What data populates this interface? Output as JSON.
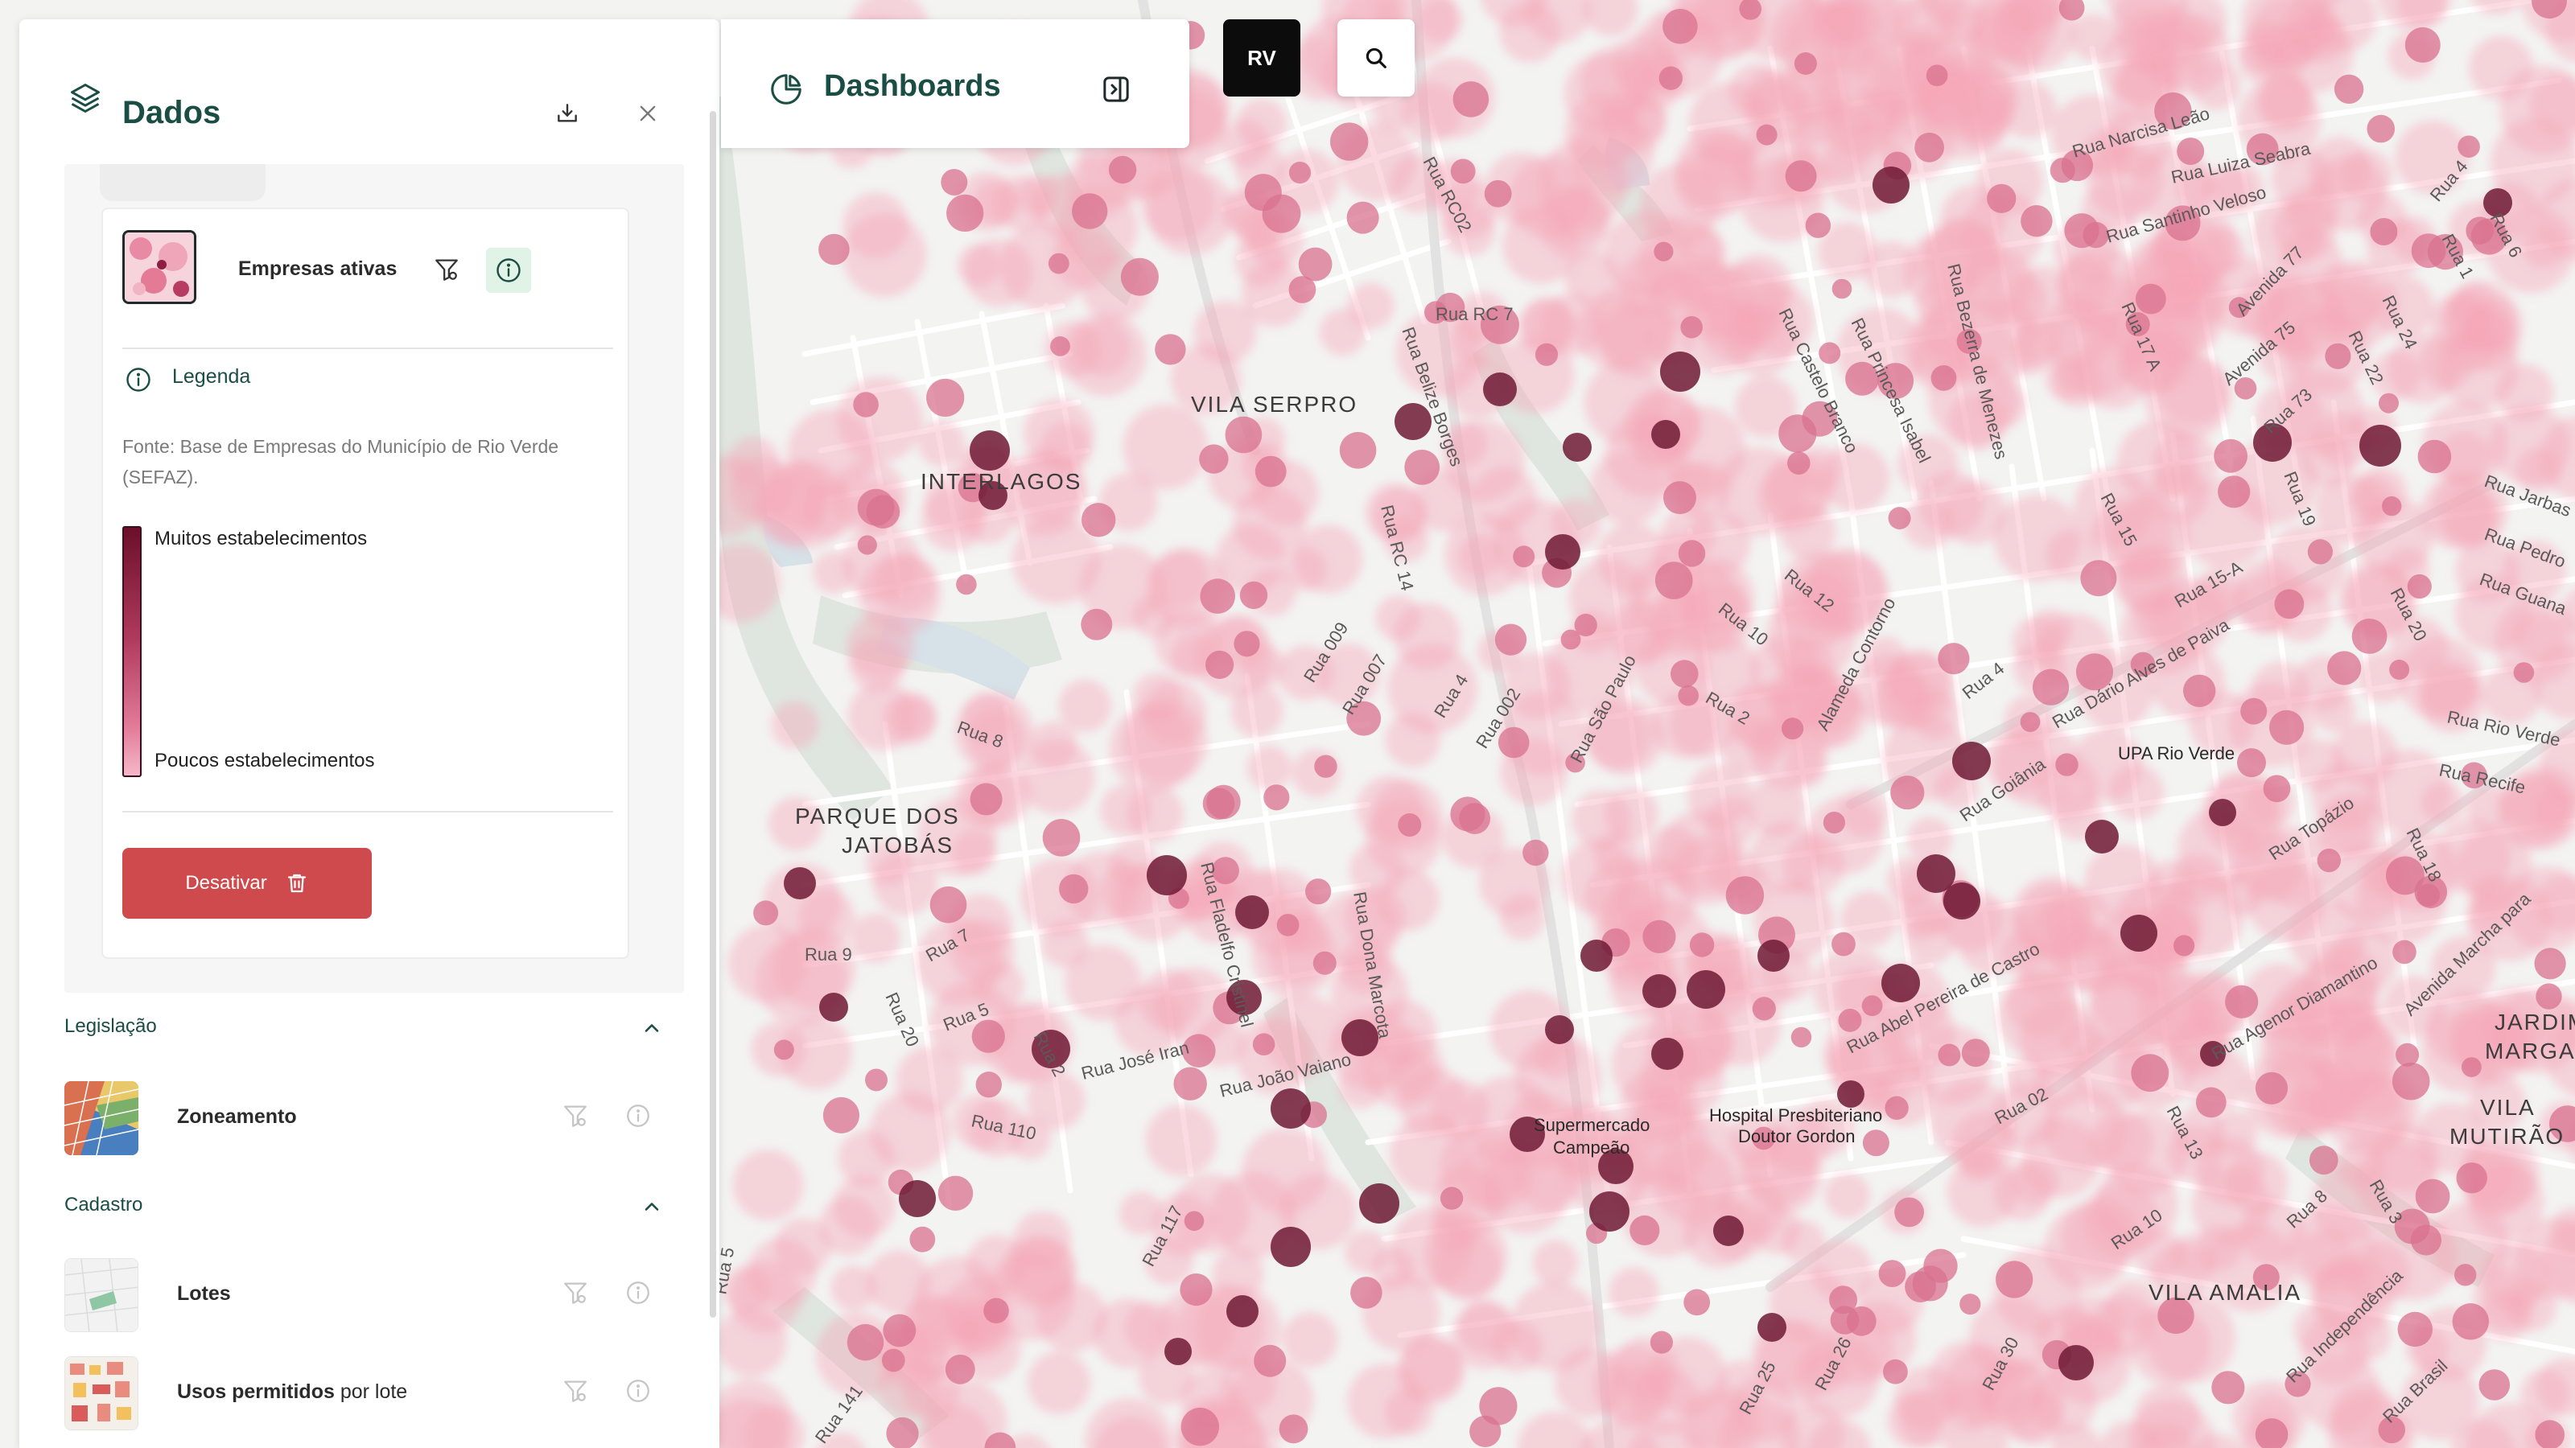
{
  "panel": {
    "title": "Dados",
    "active_layer": {
      "name": "Empresas ativas",
      "legend_label": "Legenda",
      "source": "Fonte: Base de Empresas do Município de Rio Verde (SEFAZ).",
      "legend_high": "Muitos estabelecimentos",
      "legend_low": "Poucos estabelecimentos",
      "deactivate_label": "Desativar"
    },
    "sections": [
      {
        "title": "Legislação",
        "layers": [
          {
            "name": "Zoneamento",
            "name_suffix": ""
          }
        ]
      },
      {
        "title": "Cadastro",
        "layers": [
          {
            "name": "Lotes",
            "name_suffix": ""
          },
          {
            "name": "Usos permitidos",
            "name_suffix": " por lote"
          }
        ]
      }
    ]
  },
  "dashboards": {
    "title": "Dashboards"
  },
  "city_button": {
    "label": "RV"
  },
  "map": {
    "neighborhoods": [
      "VILA SERPRO",
      "INTERLAGOS",
      "PARQUE DOS JATOBÁS",
      "VILA AMALIA",
      "JARDIM MARGA",
      "VILA MUTIRÃO"
    ],
    "pois": [
      "UPA Rio Verde",
      "Supermercado Campeão",
      "Hospital Presbiteriano Doutor Gordon"
    ],
    "streets": [
      "Rua RC02",
      "Rua RC 7",
      "Rua Belize Borges",
      "Rua RC 14",
      "Rua 009",
      "Rua 007",
      "Rua 4",
      "Rua 002",
      "Rua São Paulo",
      "Rua 10",
      "Rua 12",
      "Rua 2",
      "Alameda Contorno",
      "Rua 4",
      "Rua Dário Alves de Paiva",
      "Rua 15-A",
      "Rua 15",
      "Rua Narcisa Leão",
      "Rua Luiza Seabra",
      "Rua Santinho Veloso",
      "Rua Castelo Branco",
      "Rua Princesa Isabel",
      "Rua Bezerra de Menezes",
      "Rua 17 A",
      "Avenida 77",
      "Avenida 75",
      "Rua 73",
      "Rua 19",
      "Rua 22",
      "Rua 24",
      "Rua 8",
      "Rua 9",
      "Rua 7",
      "Rua 5",
      "Rua 20",
      "Rua 2",
      "Rua 110",
      "Rua José Iran",
      "Rua João Vaiano",
      "Rua Fladelfo Cristinel",
      "Rua Dona Marcota",
      "Rua Goiânia",
      "Rua Abel Pereira de Castro",
      "Rua Agenor Diamantino",
      "Rua Topázio",
      "Rua 02",
      "Rua 117",
      "Rua 10",
      "Rua 8",
      "Rua 13",
      "Rua 25",
      "Rua 26",
      "Rua 30",
      "Rua Independência",
      "Rua Brasil",
      "Rua Recife",
      "Rua Rio Verde",
      "Rua 18",
      "Avenida Marcha para",
      "Rua 141",
      "Rua 5",
      "Rua Jarbas",
      "Rua Pedro",
      "Rua Guana",
      "Rua 20",
      "Rua 6",
      "Rua 4",
      "Rua 1",
      "Rua 3"
    ]
  },
  "colors": {
    "accent": "#1a4d44",
    "danger": "#cf4a4c",
    "heat_low": "#f5b7c8",
    "heat_high": "#6b0f2b"
  },
  "icons": [
    "layers-icon",
    "download-icon",
    "close-icon",
    "filter-icon",
    "info-icon",
    "trash-icon",
    "chevron-up-icon",
    "dashboard-pie-icon",
    "panel-collapse-icon",
    "search-icon"
  ]
}
